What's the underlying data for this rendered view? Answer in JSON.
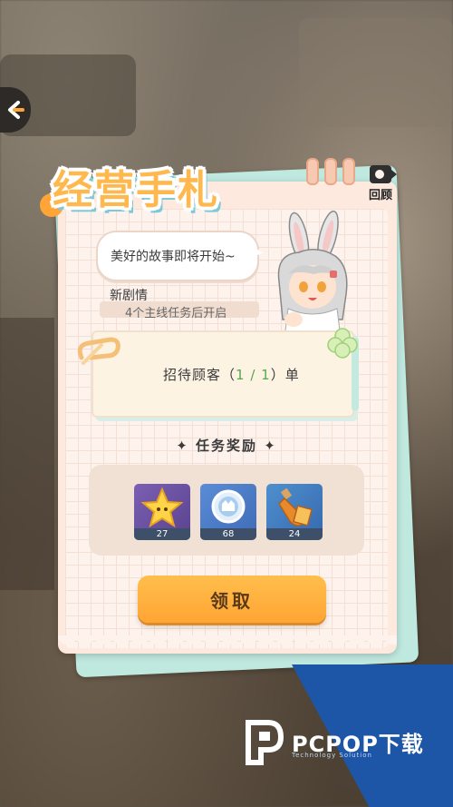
{
  "app": {
    "title": "经营手札",
    "review_label": "回顾"
  },
  "story": {
    "bubble_text": "美好的故事即将开始~",
    "plot_title": "新剧情",
    "plot_desc": "4个主线任务后开启"
  },
  "task": {
    "prefix": "招待顾客（",
    "progress": "1 / 1",
    "suffix": "）单"
  },
  "rewards": {
    "title": "✦ 任务奖励 ✦",
    "items": [
      {
        "icon": "star-icon",
        "qty": "27"
      },
      {
        "icon": "coin-badge-icon",
        "qty": "68"
      },
      {
        "icon": "drink-bottle-icon",
        "qty": "24"
      }
    ]
  },
  "actions": {
    "claim_label": "领取"
  },
  "watermark": {
    "brand": "PCPOP下载",
    "sub": "Technology Solution"
  },
  "colors": {
    "accent": "#ffa534",
    "progress": "#58a84b",
    "card_bg": "#fdf3ec",
    "teal": "#bfe8df"
  }
}
